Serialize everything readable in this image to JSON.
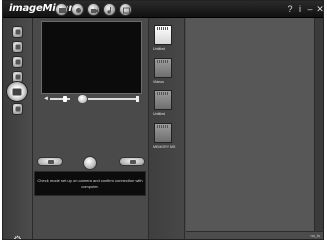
{
  "app": {
    "title": "imageMixer"
  },
  "toolbar": {
    "mode_icons": [
      "capture-icon",
      "album-icon",
      "video-icon",
      "music-icon",
      "web-icon",
      "share-icon"
    ]
  },
  "window": {
    "help_icon": "help-icon",
    "info_icon": "info-icon",
    "minimize_label": "–",
    "close_label": "✕"
  },
  "rail": {
    "items": [
      "folder",
      "camera",
      "photo",
      "video",
      "capture",
      "drive"
    ],
    "active": "capture"
  },
  "preview": {
    "volume_icon": "◄",
    "message": "Check mode set up on camera and confirm connection with computer."
  },
  "sources": [
    {
      "label": "Untitled",
      "sub": ""
    },
    {
      "label": "Videos",
      "sub": ""
    },
    {
      "label": "Untitled",
      "sub": ""
    },
    {
      "label": "MEMORY MS",
      "sub": ""
    }
  ],
  "status": {
    "text": "no_ls"
  },
  "colors": {
    "background": "#4a4a4a",
    "titlebar": "#111111",
    "preview": "#0b0b0b",
    "accent": "#ffffff"
  }
}
